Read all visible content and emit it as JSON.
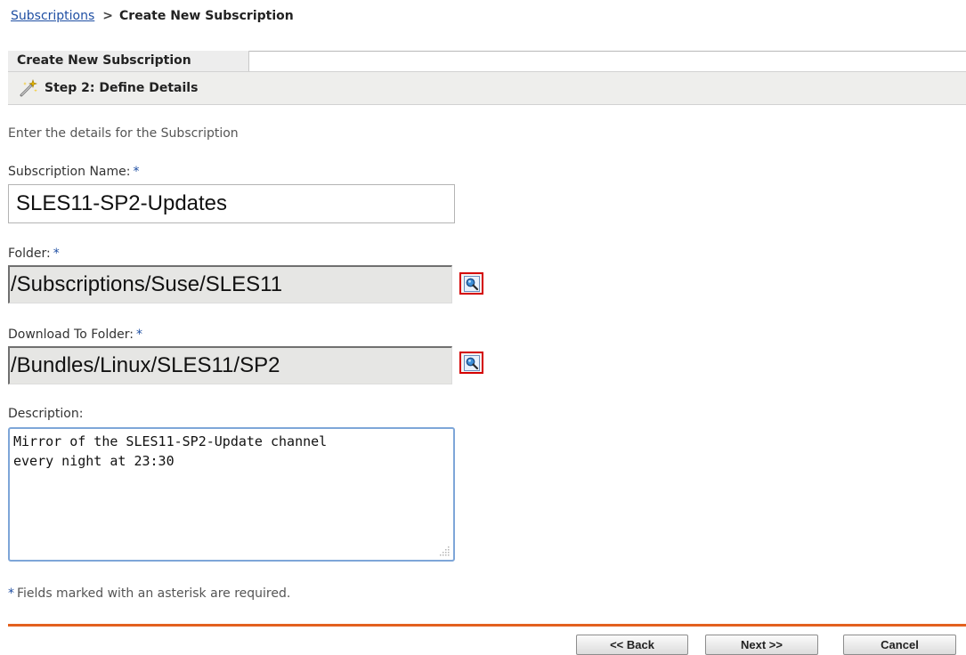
{
  "breadcrumb": {
    "parent_link": "Subscriptions",
    "separator": ">",
    "current": "Create New Subscription"
  },
  "wizard": {
    "tab_label": "Create New Subscription",
    "step_icon": "magic-wand-icon",
    "step_label": "Step 2: Define Details",
    "intro_text": "Enter the details for the Subscription"
  },
  "form": {
    "required_marker": "*",
    "subscription_name": {
      "label": "Subscription Name:",
      "value": "SLES11-SP2-Updates"
    },
    "folder": {
      "label": "Folder:",
      "value": "/Subscriptions/Suse/SLES11",
      "browse_icon": "magnifier-icon"
    },
    "download_folder": {
      "label": "Download To Folder:",
      "value": "/Bundles/Linux/SLES11/SP2",
      "browse_icon": "magnifier-icon"
    },
    "description": {
      "label": "Description:",
      "lines": [
        "Mirror of the SLES11-SP2-Update channel",
        "every night at 23:30"
      ]
    }
  },
  "footnote": {
    "marker": "*",
    "text": "Fields marked with an asterisk are required."
  },
  "buttons": {
    "back": "<< Back",
    "next": "Next >>",
    "cancel": "Cancel"
  },
  "colors": {
    "link": "#1f4fa3",
    "required": "#1f4fa3",
    "accent_rule": "#e3601e",
    "browse_border": "#d40000",
    "textarea_focus": "#7ea6d8"
  }
}
